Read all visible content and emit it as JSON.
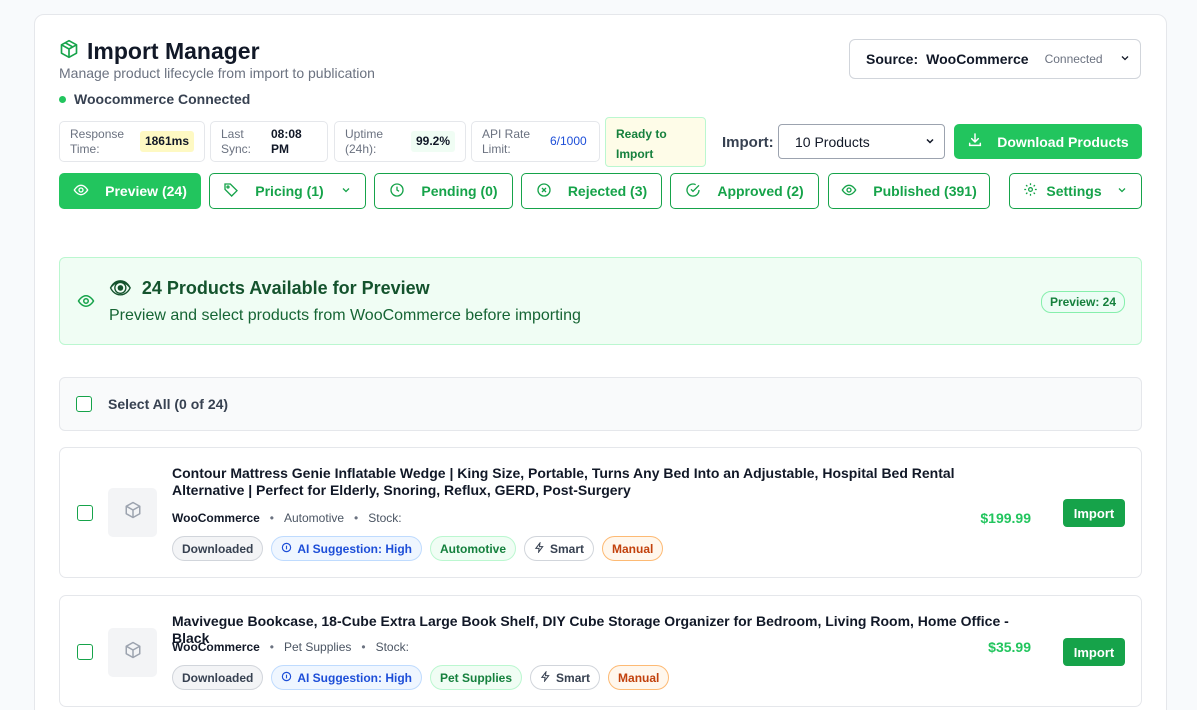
{
  "header": {
    "title": "Import Manager",
    "subtitle": "Manage product lifecycle from import to publication",
    "connection_status": "Woocommerce Connected"
  },
  "source": {
    "label": "Source:",
    "value": "WooCommerce",
    "status": "Connected"
  },
  "stats": {
    "response_time": {
      "label": "Response Time:",
      "value": "1861ms"
    },
    "last_sync": {
      "label": "Last Sync:",
      "value": "08:08 PM"
    },
    "uptime": {
      "label": "Uptime (24h):",
      "value": "99.2%"
    },
    "api_rate": {
      "label": "API Rate Limit:",
      "value": "6/1000"
    },
    "ready": "Ready to Import"
  },
  "import": {
    "label": "Import:",
    "selected": "10 Products",
    "download_label": "Download Products"
  },
  "tabs": [
    {
      "label": "Preview (24)"
    },
    {
      "label": "Pricing (1)"
    },
    {
      "label": "Pending (0)"
    },
    {
      "label": "Rejected (3)"
    },
    {
      "label": "Approved (2)"
    },
    {
      "label": "Published (391)"
    },
    {
      "label": "Settings"
    }
  ],
  "banner": {
    "emoji": "👁",
    "title": "24 Products Available for Preview",
    "text": "Preview and select products from WooCommerce before importing",
    "badge": "Preview: 24"
  },
  "select_all": "Select All (0 of 24)",
  "products": [
    {
      "name": "Contour Mattress Genie Inflatable Wedge | King Size, Portable, Turns Any Bed Into an Adjustable, Hospital Bed Rental Alternative | Perfect for Elderly, Snoring, Reflux, GERD, Post-Surgery",
      "source": "WooCommerce",
      "category": "Automotive",
      "stock": "Stock:",
      "price": "$199.99",
      "tags": [
        "Downloaded",
        "AI Suggestion: High",
        "Automotive",
        "Smart",
        "Manual"
      ],
      "import_label": "Import"
    },
    {
      "name": "Mavivegue Bookcase, 18-Cube Extra Large Book Shelf, DIY Cube Storage Organizer for Bedroom, Living Room, Home Office - Black",
      "source": "WooCommerce",
      "category": "Pet Supplies",
      "stock": "Stock:",
      "price": "$35.99",
      "tags": [
        "Downloaded",
        "AI Suggestion: High",
        "Pet Supplies",
        "Smart",
        "Manual"
      ],
      "import_label": "Import"
    }
  ]
}
